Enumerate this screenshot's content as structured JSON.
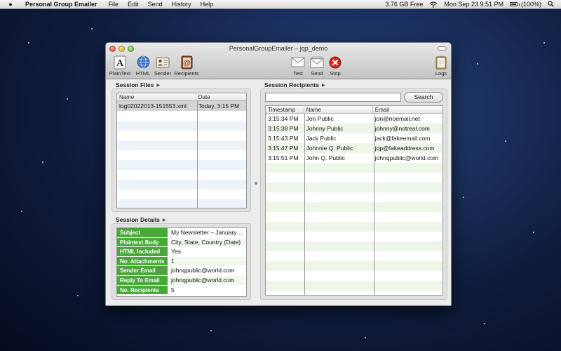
{
  "menubar": {
    "app_name": "Personal Group Emailer",
    "menus": [
      "File",
      "Edit",
      "Send",
      "History",
      "Help"
    ],
    "disk_free": "3.76 GB Free",
    "clock": "Mon Sep 23  9:51 PM",
    "battery": "(100%)"
  },
  "window": {
    "title": "PersonalGroupEmailer – jqp_demo",
    "toolbar": {
      "plaintext": "PlainText",
      "html": "HTML",
      "sender": "Sender",
      "recipients": "Recipients",
      "test": "Test",
      "send": "Send",
      "stop": "Stop",
      "logs": "Logs"
    }
  },
  "session_files": {
    "title": "Session Files",
    "columns": [
      "Name",
      "Date"
    ],
    "rows": [
      {
        "name": "log02022013-151553.xml",
        "date": "Today, 3:15 PM"
      }
    ]
  },
  "session_details": {
    "title": "Session Details",
    "rows": [
      {
        "key": "Subject",
        "value": "My Newsletter – January ..."
      },
      {
        "key": "Plaintext Body",
        "value": "City, State, Country (Date)"
      },
      {
        "key": "HTML Included",
        "value": "Yes"
      },
      {
        "key": "No. Attachments",
        "value": "1"
      },
      {
        "key": "Sender Email",
        "value": " johnqpublic@world.com"
      },
      {
        "key": "Reply To Email",
        "value": " johnqpublic@world.com"
      },
      {
        "key": "No. Recipients",
        "value": "5"
      }
    ]
  },
  "session_recipients": {
    "title": "Session Recipients",
    "search_value": "",
    "search_button": "Search",
    "columns": [
      "Timestamp",
      "Name",
      "Email"
    ],
    "rows": [
      {
        "timestamp": "3:15:34 PM",
        "name": "Jon Public",
        "email": "jon@noemail.net"
      },
      {
        "timestamp": "3:15:38 PM",
        "name": "Johnny Public",
        "email": "johnny@notreal.com"
      },
      {
        "timestamp": "3:15:43 PM",
        "name": "Jack Public",
        "email": "jack@fakeemail.com"
      },
      {
        "timestamp": "3:15:47 PM",
        "name": "Johnnie Q. Public",
        "email": "jqp@fakeaddress.com"
      },
      {
        "timestamp": "3:15:51 PM",
        "name": "John Q. Public",
        "email": "johnqpublic@world.com"
      }
    ]
  },
  "colors": {
    "detail_key_bg": "#4aa83b",
    "stop_red": "#d8261e",
    "accent_blue": "#2a62b8"
  }
}
